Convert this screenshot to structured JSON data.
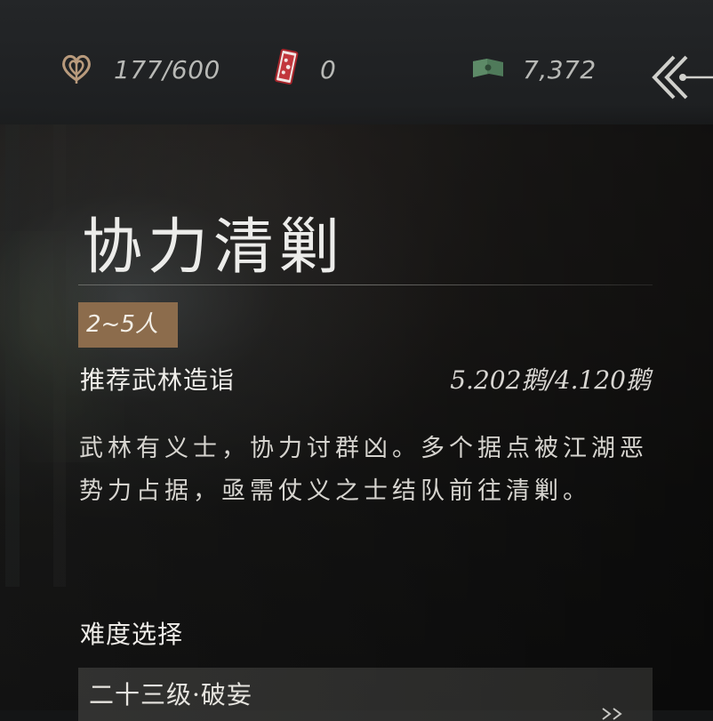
{
  "resources": {
    "stamina": "177/600",
    "tickets": "0",
    "money": "7,372"
  },
  "icons": {
    "stamina": "heart-knot-icon",
    "tickets": "red-token-icon",
    "money": "banknote-icon",
    "back": "double-chevron-back-icon"
  },
  "colors": {
    "accent_badge": "#8c6c4c",
    "stamina_icon": "#b89a7c",
    "ticket_icon": "#c2373d",
    "money_icon": "#4f7a5a"
  },
  "activity": {
    "title": "协力清剿",
    "party_size": "2~5人",
    "recommend_label": "推荐武林造诣",
    "recommend_value": "5.202鹅/4.120鹅",
    "description": "武林有义士，协力讨群凶。多个据点被江湖恶势力占据，亟需仗义之士结队前往清剿。"
  },
  "difficulty": {
    "label": "难度选择",
    "selected": "二十三级·破妄"
  }
}
